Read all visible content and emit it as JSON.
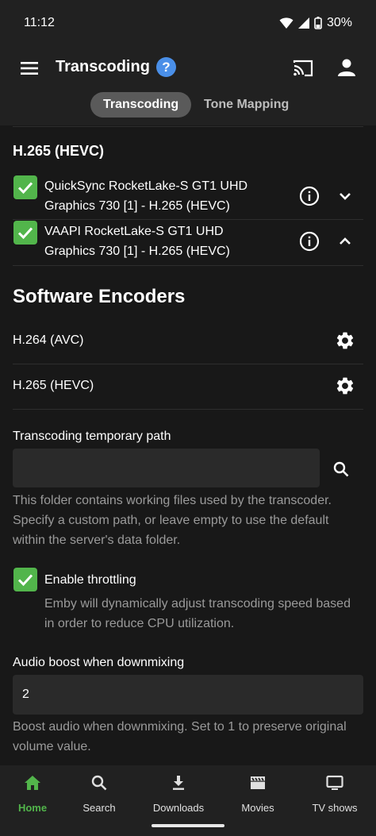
{
  "status": {
    "time": "11:12",
    "battery": "30%"
  },
  "header": {
    "title": "Transcoding",
    "tabs": [
      {
        "label": "Transcoding",
        "active": true
      },
      {
        "label": "Tone Mapping",
        "active": false
      }
    ]
  },
  "hevc_section": {
    "title": "H.265 (HEVC)",
    "items": [
      {
        "line1": "QuickSync RocketLake-S GT1 UHD",
        "line2": "Graphics 730 [1] - H.265 (HEVC)",
        "checked": true,
        "expanded": false
      },
      {
        "line1": "VAAPI RocketLake-S GT1 UHD",
        "line2": "Graphics 730 [1] - H.265 (HEVC)",
        "checked": true,
        "expanded": true
      }
    ]
  },
  "software_encoders": {
    "title": "Software Encoders",
    "items": [
      {
        "label": "H.264 (AVC)"
      },
      {
        "label": "H.265 (HEVC)"
      }
    ]
  },
  "temp_path": {
    "label": "Transcoding temporary path",
    "value": "",
    "help_lines": [
      "This folder contains working files used by the transcoder.",
      "Specify a custom path, or leave empty to use the default",
      "within the server's data folder."
    ]
  },
  "throttling": {
    "label": "Enable throttling",
    "checked": true,
    "help_lines": [
      "Emby will dynamically adjust transcoding speed based",
      "in order to reduce CPU utilization."
    ]
  },
  "audio_boost": {
    "label": "Audio boost when downmixing",
    "value": "2",
    "help_lines": [
      "Boost audio when downmixing. Set to 1 to preserve original",
      "volume value."
    ]
  },
  "nav": {
    "items": [
      {
        "label": "Home",
        "icon": "home-icon",
        "active": true
      },
      {
        "label": "Search",
        "icon": "search-icon",
        "active": false
      },
      {
        "label": "Downloads",
        "icon": "download-icon",
        "active": false
      },
      {
        "label": "Movies",
        "icon": "movie-icon",
        "active": false
      },
      {
        "label": "TV shows",
        "icon": "tv-icon",
        "active": false
      }
    ]
  },
  "colors": {
    "accent_green": "#52b54b",
    "help_blue": "#4a8fe8",
    "surface": "#212121",
    "background": "#181818"
  }
}
